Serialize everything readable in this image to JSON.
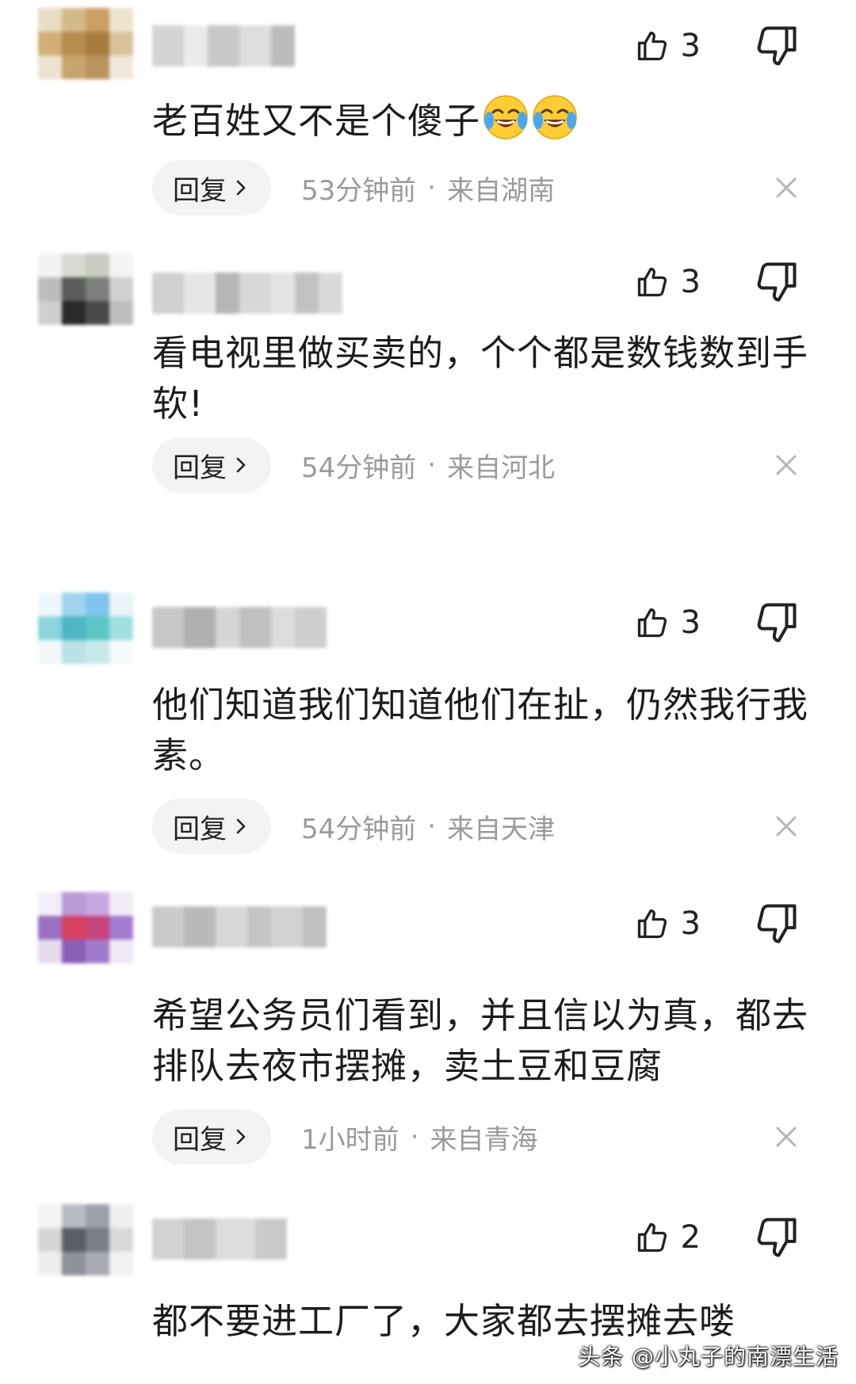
{
  "comments": [
    {
      "likes": "3",
      "text": "老百姓又不是个傻子",
      "emoji_name": "crying-laughing-emoji",
      "reply_label": "回复",
      "time": "53分钟前",
      "location": "来自湖南"
    },
    {
      "likes": "3",
      "text": "看电视里做买卖的，个个都是数钱数到手软!",
      "reply_label": "回复",
      "time": "54分钟前",
      "location": "来自河北"
    },
    {
      "likes": "3",
      "text": "他们知道我们知道他们在扯，仍然我行我素。",
      "reply_label": "回复",
      "time": "54分钟前",
      "location": "来自天津"
    },
    {
      "likes": "3",
      "text": "希望公务员们看到，并且信以为真，都去排队去夜市摆摊，卖土豆和豆腐",
      "reply_label": "回复",
      "time": "1小时前",
      "location": "来自青海"
    },
    {
      "likes": "2",
      "text": "都不要进工厂了，大家都去摆摊去喽"
    }
  ],
  "separator": "·",
  "watermark": "头条 @小丸子的南漂生活",
  "icons": {
    "like": "thumbs-up-icon",
    "dislike": "thumbs-down-icon",
    "reply_arrow": "chevron-right-icon",
    "close": "close-icon"
  },
  "colors": {
    "meta_text": "#9a9a9a",
    "reply_bg": "#f3f3f3"
  }
}
